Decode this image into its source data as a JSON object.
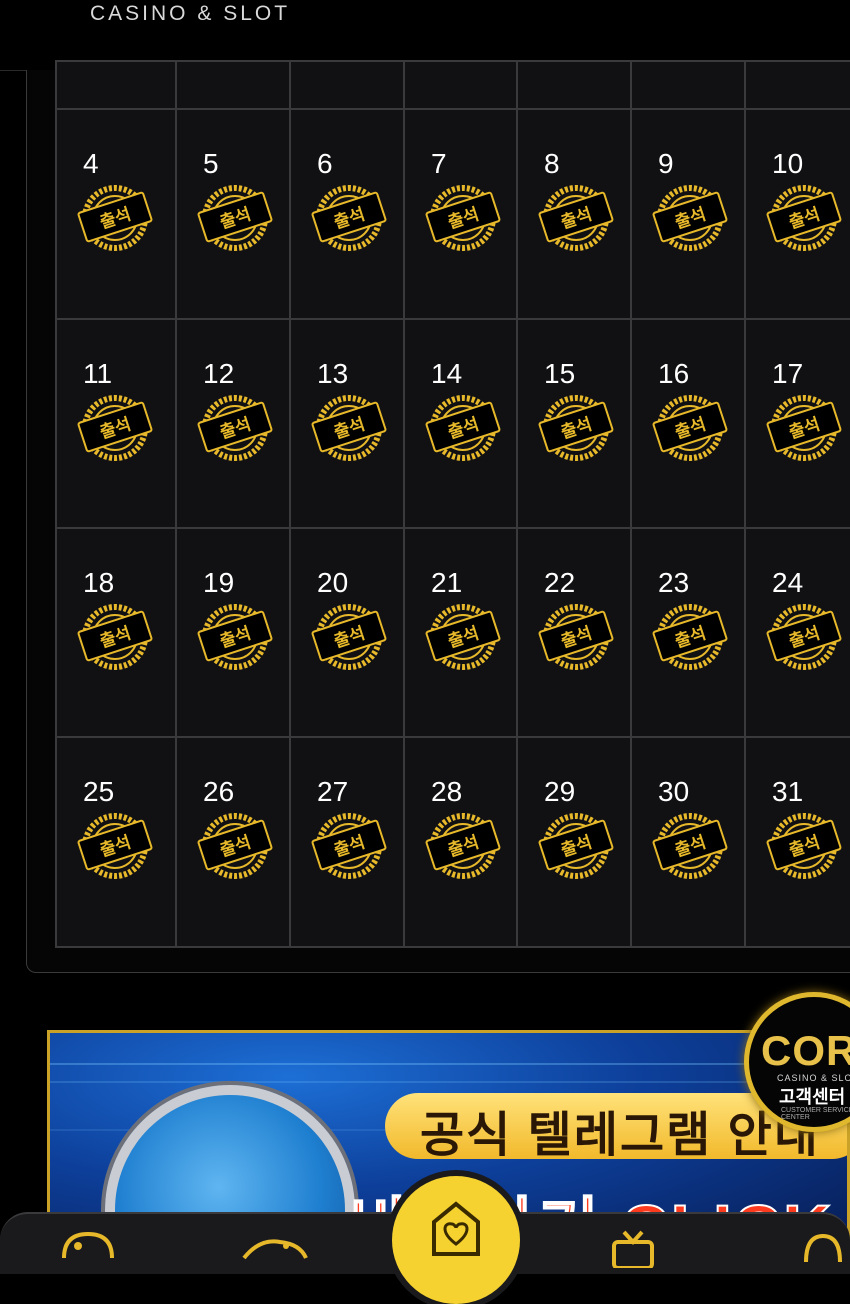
{
  "header": {
    "brand": "CASINO & SLOT"
  },
  "calendar": {
    "stamp_label": "출석",
    "weeks": [
      [
        "4",
        "5",
        "6",
        "7",
        "8",
        "9",
        "10"
      ],
      [
        "11",
        "12",
        "13",
        "14",
        "15",
        "16",
        "17"
      ],
      [
        "18",
        "19",
        "20",
        "21",
        "22",
        "23",
        "24"
      ],
      [
        "25",
        "26",
        "27",
        "28",
        "29",
        "30",
        "31"
      ]
    ]
  },
  "banner": {
    "headline": "공식 텔레그램 안내",
    "cta": "바로가기 CLICK"
  },
  "customer_service": {
    "logo": "COR",
    "sub": "CASINO & SLOT",
    "title": "고객센터",
    "tiny": "CUSTOMER SERVICE CENTER"
  },
  "colors": {
    "gold": "#e7b92a",
    "cell_bg": "#111113",
    "grid_line": "#3a3a3c",
    "nav_center": "#f5d230"
  },
  "bottom_nav": {
    "icons": [
      "casino-icon",
      "slot-icon",
      "home-heart-icon",
      "event-icon",
      "support-icon"
    ]
  }
}
